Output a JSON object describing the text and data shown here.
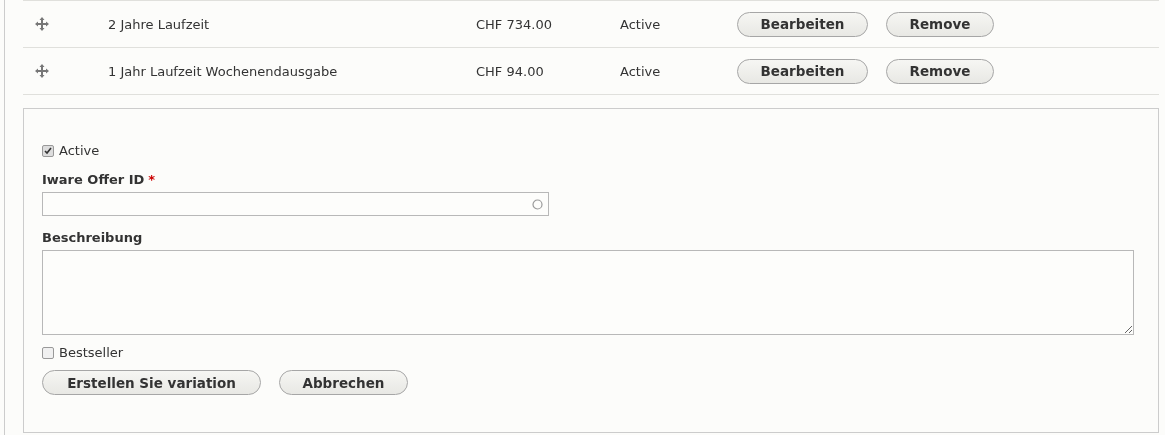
{
  "variations": [
    {
      "title": "2 Jahre Laufzeit",
      "price": "CHF 734.00",
      "status": "Active",
      "buttons": [
        "Bearbeiten",
        "Remove"
      ]
    },
    {
      "title": "1 Jahr Laufzeit Wochenendausgabe",
      "price": "CHF 94.00",
      "status": "Active",
      "buttons": [
        "Bearbeiten",
        "Remove"
      ]
    }
  ],
  "form": {
    "active": {
      "label": "Active",
      "checked": true
    },
    "offer_id": {
      "label": "Iware Offer ID",
      "required_mark": "*"
    },
    "description": {
      "label": "Beschreibung"
    },
    "bestseller": {
      "label": "Bestseller",
      "checked": false
    },
    "buttons": [
      "Erstellen Sie variation",
      "Abbrechen"
    ]
  }
}
